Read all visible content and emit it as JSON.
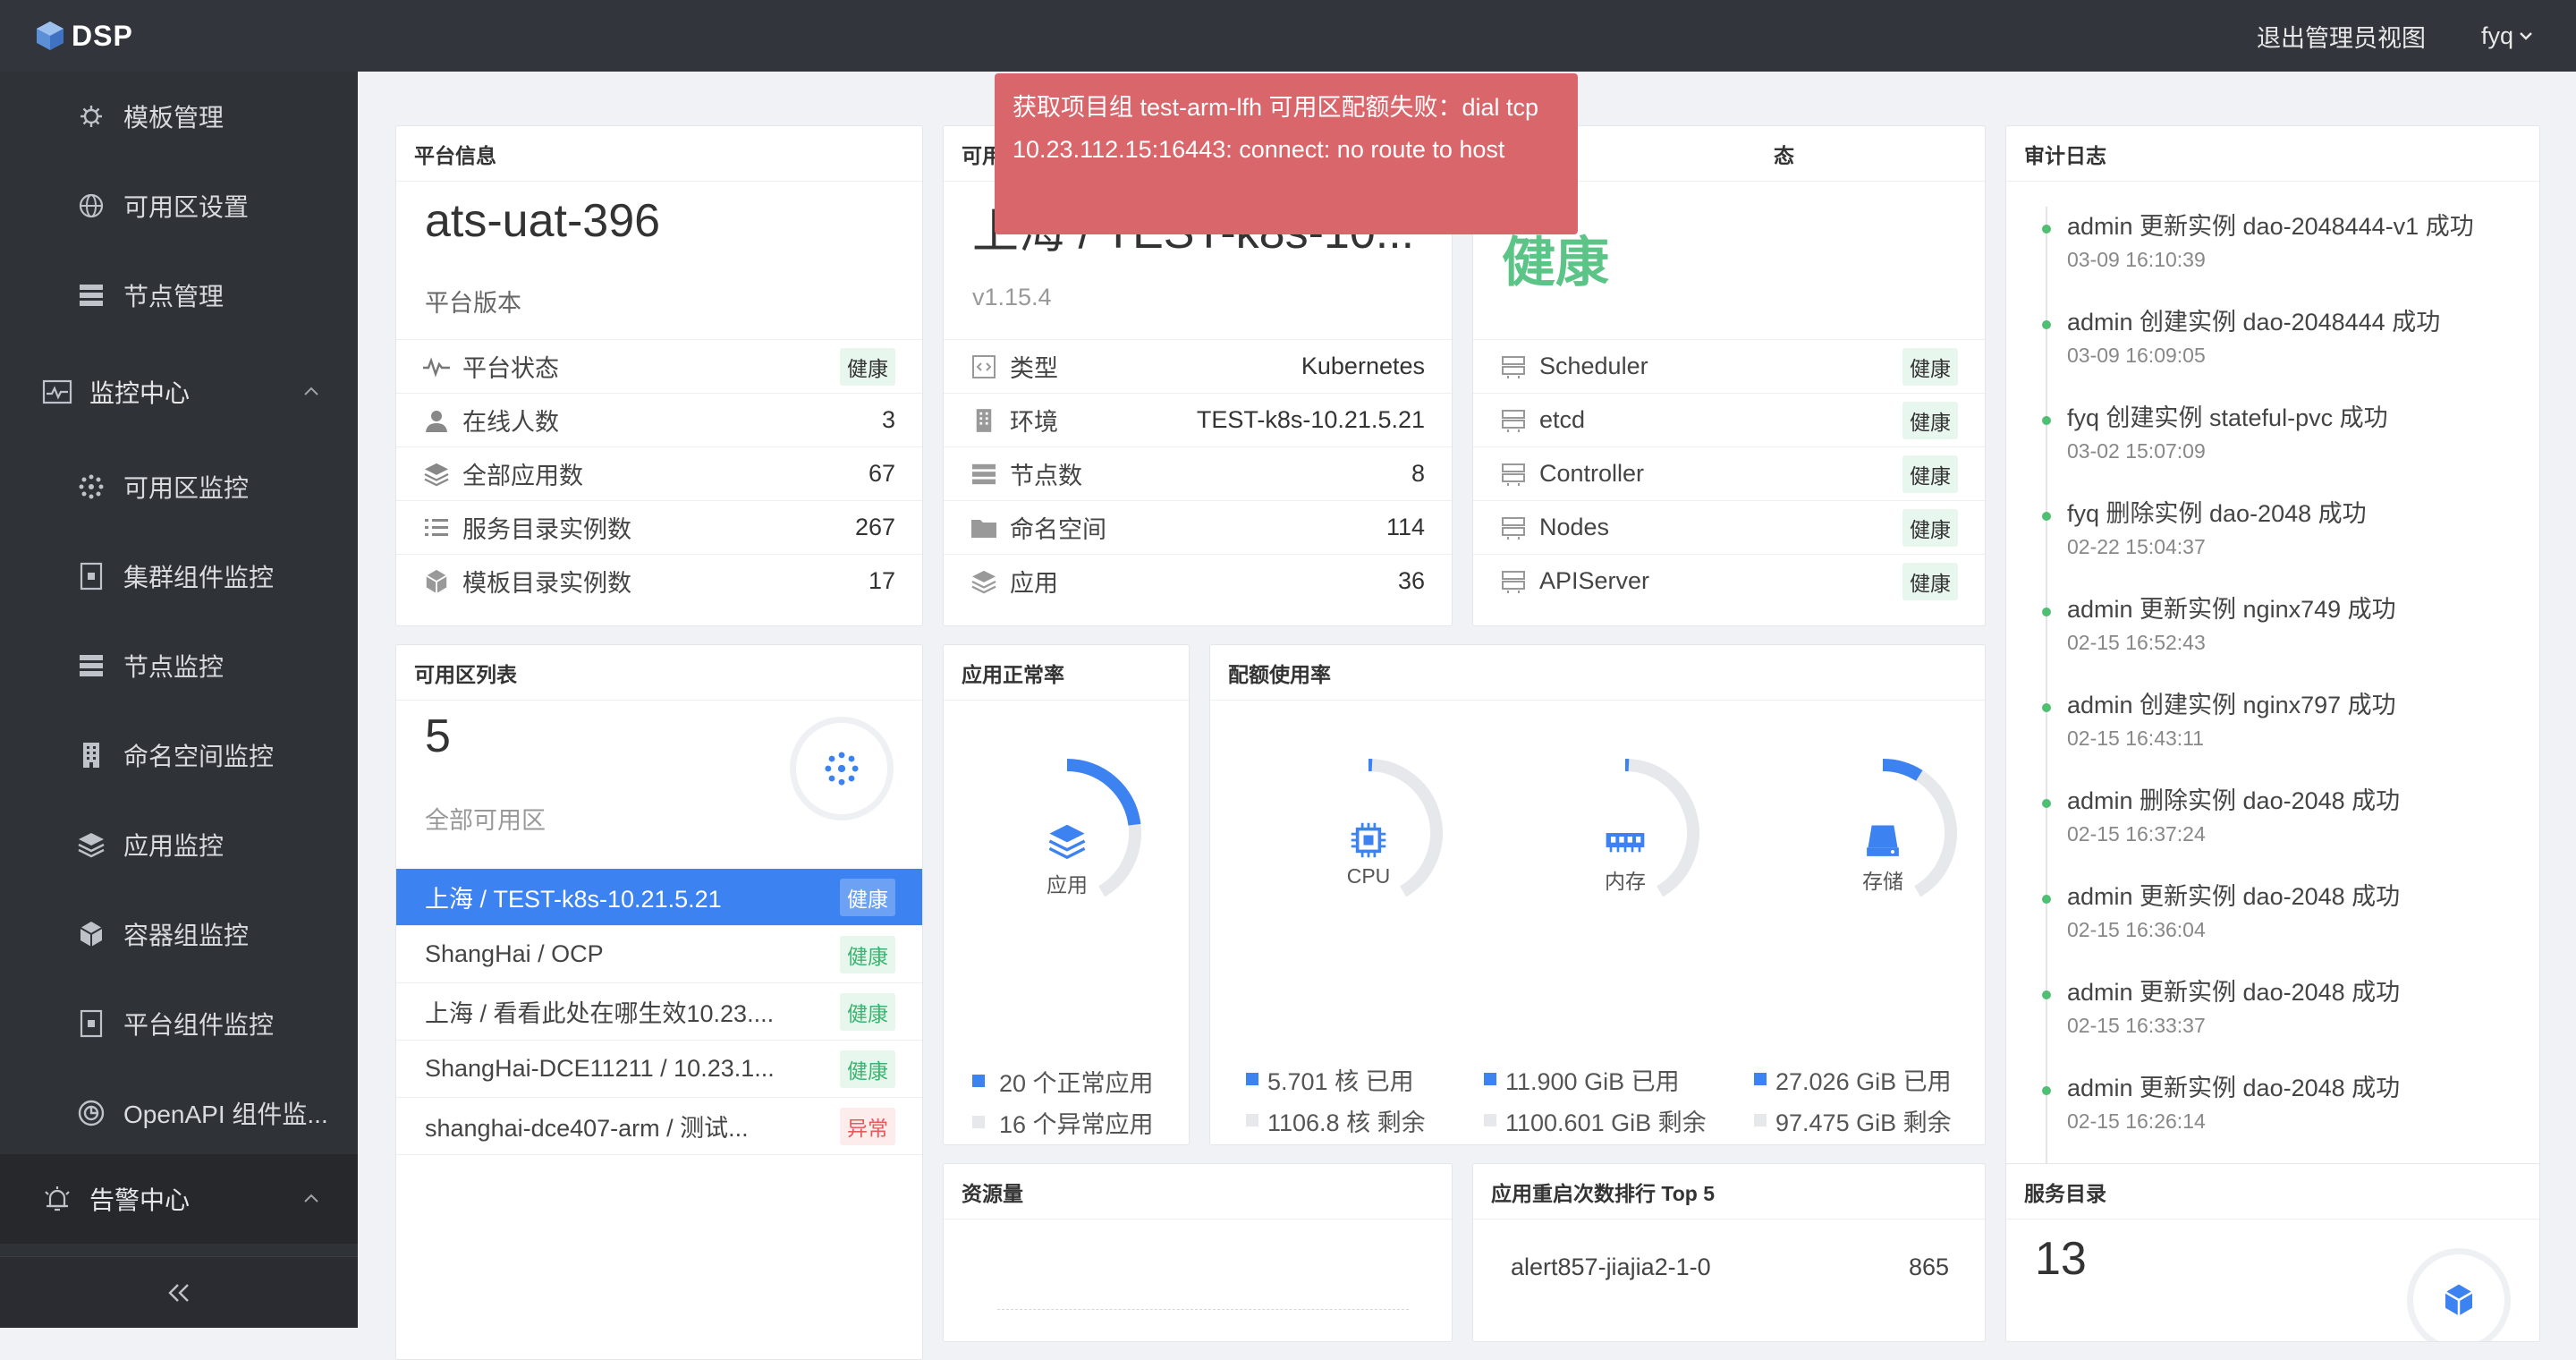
{
  "topbar": {
    "logo_text": "DSP",
    "exit_admin": "退出管理员视图",
    "user": "fyq"
  },
  "sidebar": {
    "items": [
      {
        "label": "模板管理",
        "icon": "template-icon"
      },
      {
        "label": "可用区设置",
        "icon": "globe-icon"
      },
      {
        "label": "节点管理",
        "icon": "server-icon"
      }
    ],
    "monitor_group": "监控中心",
    "monitor_items": [
      {
        "label": "可用区监控",
        "icon": "cluster-dots-icon"
      },
      {
        "label": "集群组件监控",
        "icon": "component-icon"
      },
      {
        "label": "节点监控",
        "icon": "server-icon"
      },
      {
        "label": "命名空间监控",
        "icon": "building-icon"
      },
      {
        "label": "应用监控",
        "icon": "layers-icon"
      },
      {
        "label": "容器组监控",
        "icon": "cube-icon"
      },
      {
        "label": "平台组件监控",
        "icon": "component-icon"
      },
      {
        "label": "OpenAPI 组件监...",
        "icon": "openapi-icon"
      }
    ],
    "alert_group": "告警中心"
  },
  "error_toast": "获取项目组 test-arm-lfh 可用区配额失败：dial tcp 10.23.112.15:16443: connect: no route to host",
  "platform_info": {
    "title": "平台信息",
    "name": "ats-uat-396",
    "version_label": "平台版本",
    "rows": [
      {
        "label": "平台状态",
        "value": "健康",
        "badge": true,
        "icon": "pulse-icon"
      },
      {
        "label": "在线人数",
        "value": "3",
        "icon": "user-icon"
      },
      {
        "label": "全部应用数",
        "value": "67",
        "icon": "layers-icon"
      },
      {
        "label": "服务目录实例数",
        "value": "267",
        "icon": "list-icon"
      },
      {
        "label": "模板目录实例数",
        "value": "17",
        "icon": "cube-icon"
      }
    ]
  },
  "zone_info": {
    "title": "可用",
    "name": "上海 / TEST-k8s-10...",
    "version": "v1.15.4",
    "rows": [
      {
        "label": "类型",
        "value": "Kubernetes",
        "icon": "code-icon"
      },
      {
        "label": "环境",
        "value": "TEST-k8s-10.21.5.21",
        "icon": "building-icon"
      },
      {
        "label": "节点数",
        "value": "8",
        "icon": "server-icon"
      },
      {
        "label": "命名空间",
        "value": "114",
        "icon": "folder-icon"
      },
      {
        "label": "应用",
        "value": "36",
        "icon": "layers-icon"
      }
    ]
  },
  "component_status": {
    "title": "态",
    "status": "健康",
    "rows": [
      {
        "label": "Scheduler",
        "value": "健康"
      },
      {
        "label": "etcd",
        "value": "健康"
      },
      {
        "label": "Controller",
        "value": "健康"
      },
      {
        "label": "Nodes",
        "value": "健康"
      },
      {
        "label": "APIServer",
        "value": "健康"
      }
    ]
  },
  "audit_log": {
    "title": "审计日志",
    "items": [
      {
        "msg": "admin 更新实例 dao-2048444-v1 成功",
        "time": "03-09 16:10:39"
      },
      {
        "msg": "admin 创建实例 dao-2048444 成功",
        "time": "03-09 16:09:05"
      },
      {
        "msg": "fyq 创建实例 stateful-pvc 成功",
        "time": "03-02 15:07:09"
      },
      {
        "msg": "fyq 删除实例 dao-2048 成功",
        "time": "02-22 15:04:37"
      },
      {
        "msg": "admin 更新实例 nginx749 成功",
        "time": "02-15 16:52:43"
      },
      {
        "msg": "admin 创建实例 nginx797 成功",
        "time": "02-15 16:43:11"
      },
      {
        "msg": "admin 删除实例 dao-2048 成功",
        "time": "02-15 16:37:24"
      },
      {
        "msg": "admin 更新实例 dao-2048 成功",
        "time": "02-15 16:36:04"
      },
      {
        "msg": "admin 更新实例 dao-2048 成功",
        "time": "02-15 16:33:37"
      },
      {
        "msg": "admin 更新实例 dao-2048 成功",
        "time": "02-15 16:26:14"
      }
    ]
  },
  "zone_list": {
    "title": "可用区列表",
    "count": "5",
    "count_label": "全部可用区",
    "zones": [
      {
        "name": "上海 / TEST-k8s-10.21.5.21",
        "status": "健康",
        "ok": true,
        "active": true
      },
      {
        "name": "ShangHai / OCP",
        "status": "健康",
        "ok": true
      },
      {
        "name": "上海 / 看看此处在哪生效10.23....",
        "status": "健康",
        "ok": true
      },
      {
        "name": "ShangHai-DCE11211 / 10.23.1...",
        "status": "健康",
        "ok": true
      },
      {
        "name": "shanghai-dce407-arm / 测试...",
        "status": "异常",
        "ok": false
      }
    ]
  },
  "app_health": {
    "title": "应用正常率",
    "center_label": "应用",
    "normal": 20,
    "abnormal": 16,
    "normal_text": "20 个正常应用",
    "abnormal_text": "16 个异常应用",
    "colors": {
      "normal": "#3c82f0",
      "abnormal": "#e6e8ec"
    }
  },
  "quota": {
    "title": "配额使用率",
    "gauges": [
      {
        "label": "CPU",
        "icon": "cpu-icon",
        "used": 5.701,
        "free": 1106.8,
        "used_text": "5.701 核 已用",
        "free_text": "1106.8 核 剩余"
      },
      {
        "label": "内存",
        "icon": "memory-icon",
        "used": 11.9,
        "free": 1100.601,
        "used_text": "11.900 GiB 已用",
        "free_text": "1100.601 GiB 剩余"
      },
      {
        "label": "存储",
        "icon": "storage-icon",
        "used": 27.026,
        "free": 97.475,
        "used_text": "27.026 GiB 已用",
        "free_text": "97.475 GiB 剩余"
      }
    ]
  },
  "resource": {
    "title": "资源量"
  },
  "restart_top": {
    "title": "应用重启次数排行 Top 5",
    "items": [
      {
        "name": "alert857-jiajia2-1-0",
        "count": "865"
      }
    ]
  },
  "service_catalog": {
    "title": "服务目录",
    "count": "13"
  }
}
